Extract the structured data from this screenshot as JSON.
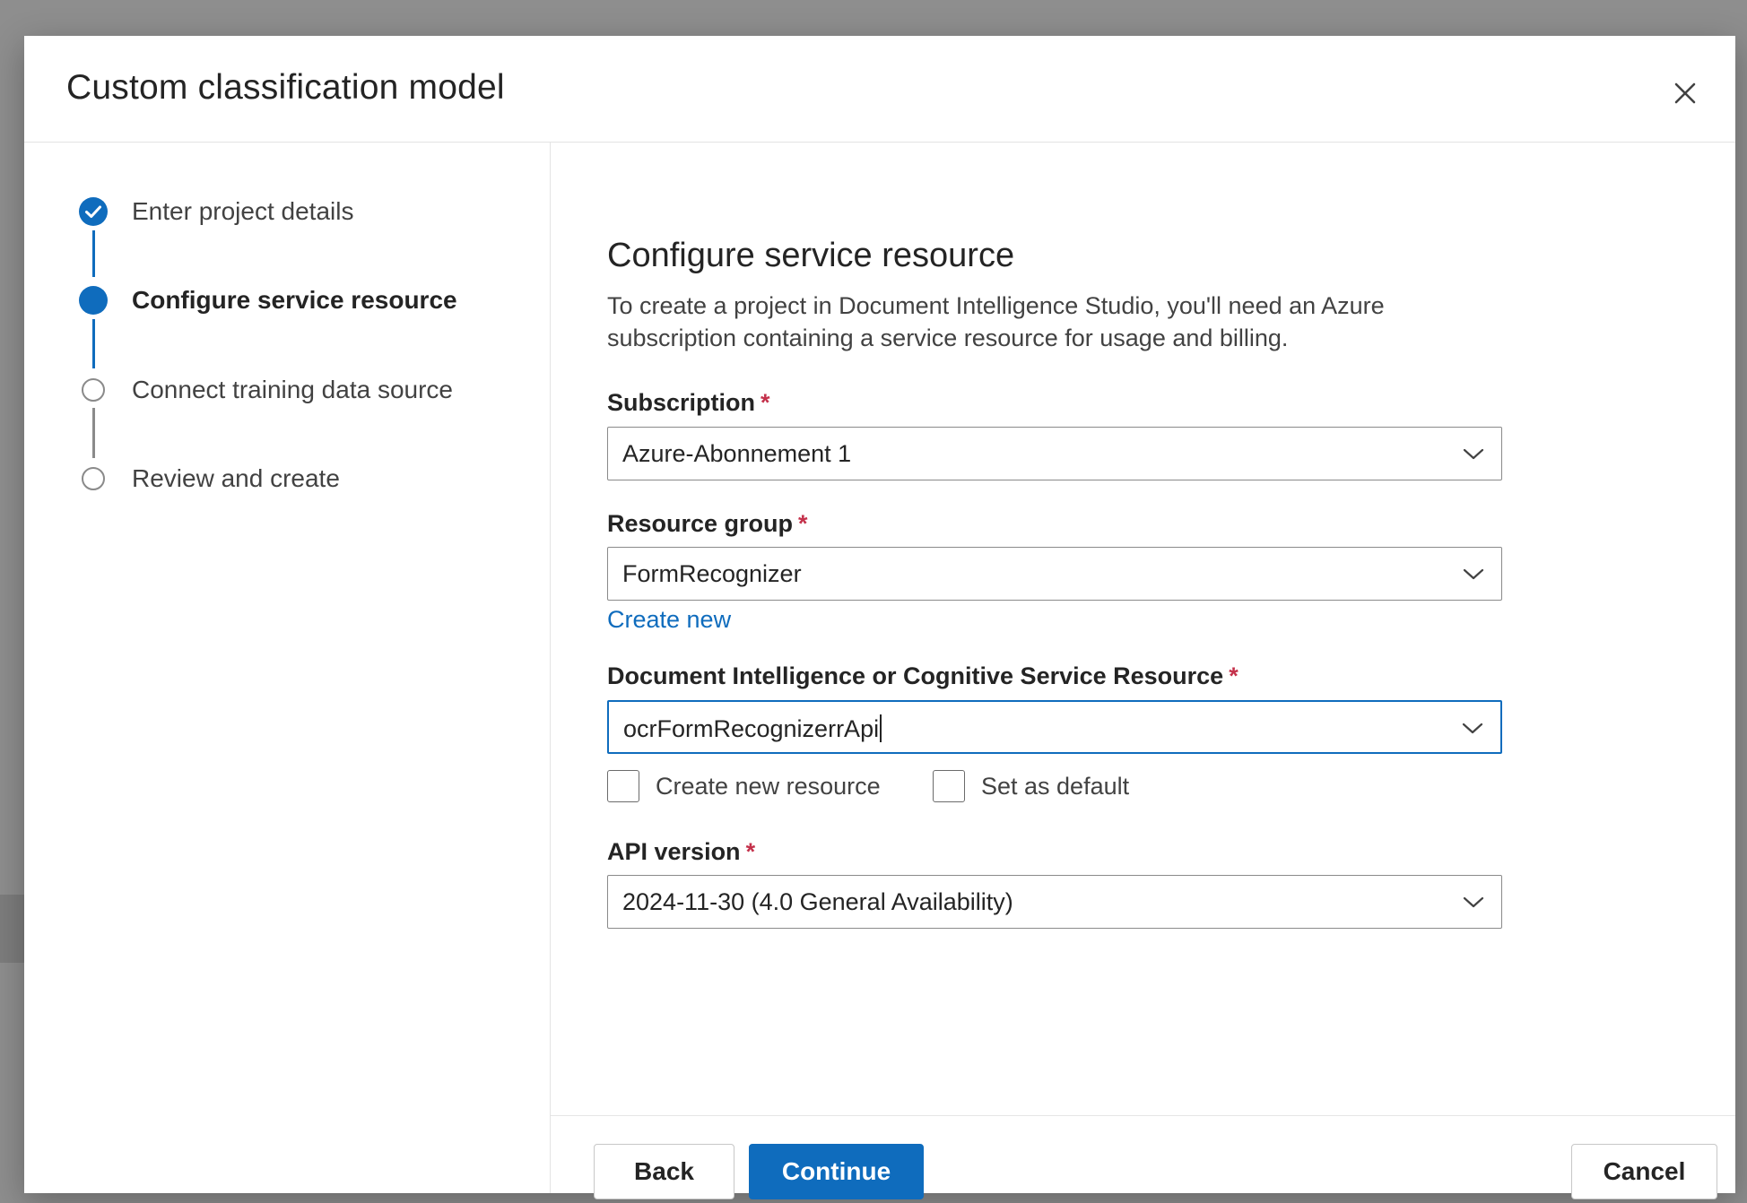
{
  "dialog": {
    "title": "Custom classification model",
    "close_icon": "close-icon"
  },
  "steps": [
    {
      "label": "Enter project details",
      "state": "completed"
    },
    {
      "label": "Configure service resource",
      "state": "current"
    },
    {
      "label": "Connect training data source",
      "state": "pending"
    },
    {
      "label": "Review and create",
      "state": "pending"
    }
  ],
  "main": {
    "title": "Configure service resource",
    "description_line1": "To create a project in Document Intelligence Studio, you'll need an Azure",
    "description_line2": "subscription containing a service resource for usage and billing.",
    "required_marker": "*",
    "subscription": {
      "label": "Subscription",
      "value": "Azure-Abonnement 1"
    },
    "resource_group": {
      "label": "Resource group",
      "value": "FormRecognizer",
      "create_new_link": "Create new"
    },
    "resource": {
      "label": "Document Intelligence or Cognitive Service Resource",
      "value": "ocrFormRecognizerrApi",
      "create_new_checkbox": {
        "label": "Create new resource",
        "checked": false
      },
      "set_default_checkbox": {
        "label": "Set as default",
        "checked": false
      }
    },
    "api_version": {
      "label": "API version",
      "value": "2024-11-30 (4.0 General Availability)"
    }
  },
  "footer": {
    "back_label": "Back",
    "continue_label": "Continue",
    "cancel_label": "Cancel"
  },
  "colors": {
    "accent": "#0f6cbd",
    "required": "#c4314b",
    "pending_step": "#8a8a8a"
  }
}
